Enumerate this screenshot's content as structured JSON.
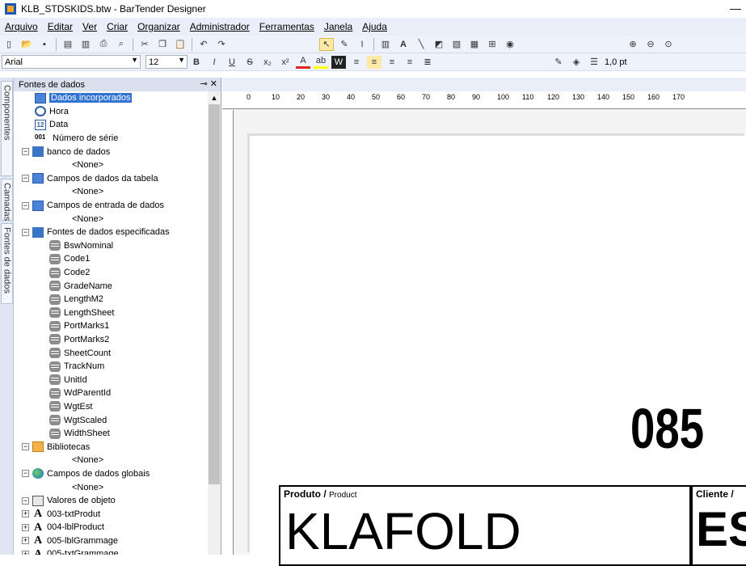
{
  "window": {
    "title": "KLB_STDSKIDS.btw - BarTender Designer",
    "min": "—"
  },
  "menu": [
    "Arquivo",
    "Editar",
    "Ver",
    "Criar",
    "Organizar",
    "Administrador",
    "Ferramentas",
    "Janela",
    "Ajuda"
  ],
  "format": {
    "font": "Arial",
    "size": "12",
    "line_width": "1,0 pt"
  },
  "sidetabs": [
    "Componentes",
    "Camadas",
    "Fontes de dados"
  ],
  "panel": {
    "title": "Fontes de dados",
    "items": [
      {
        "label": "Dados incorporados",
        "icon": "embedded-data-icon",
        "level": 1,
        "selected": true
      },
      {
        "label": "Hora",
        "icon": "clock-icon",
        "level": 1
      },
      {
        "label": "Data",
        "icon": "calendar-icon",
        "level": 1
      },
      {
        "label": "Número de série",
        "icon": "serial-number-icon",
        "level": 1
      },
      {
        "label": "banco de dados",
        "icon": "database-icon",
        "level": 0,
        "exp": "−"
      },
      {
        "label": "<None>",
        "icon": "",
        "level": 2
      },
      {
        "label": "Campos de dados da tabela",
        "icon": "table-icon",
        "level": 0,
        "exp": "−"
      },
      {
        "label": "<None>",
        "icon": "",
        "level": 2
      },
      {
        "label": "Campos de entrada de dados",
        "icon": "form-icon",
        "level": 0,
        "exp": "−"
      },
      {
        "label": "<None>",
        "icon": "",
        "level": 2
      },
      {
        "label": "Fontes de dados especificadas",
        "icon": "named-sources-icon",
        "level": 0,
        "exp": "−"
      },
      {
        "label": "BswNominal",
        "icon": "field-icon",
        "level": 2
      },
      {
        "label": "Code1",
        "icon": "field-icon",
        "level": 2
      },
      {
        "label": "Code2",
        "icon": "field-icon",
        "level": 2
      },
      {
        "label": "GradeName",
        "icon": "field-icon",
        "level": 2
      },
      {
        "label": "LengthM2",
        "icon": "field-icon",
        "level": 2
      },
      {
        "label": "LengthSheet",
        "icon": "field-icon",
        "level": 2
      },
      {
        "label": "PortMarks1",
        "icon": "field-icon",
        "level": 2
      },
      {
        "label": "PortMarks2",
        "icon": "field-icon",
        "level": 2
      },
      {
        "label": "SheetCount",
        "icon": "field-icon",
        "level": 2
      },
      {
        "label": "TrackNum",
        "icon": "field-icon",
        "level": 2
      },
      {
        "label": "UnitId",
        "icon": "field-icon",
        "level": 2
      },
      {
        "label": "WdParentId",
        "icon": "field-icon",
        "level": 2
      },
      {
        "label": "WgtEst",
        "icon": "field-icon",
        "level": 2
      },
      {
        "label": "WgtScaled",
        "icon": "field-icon",
        "level": 2
      },
      {
        "label": "WidthSheet",
        "icon": "field-icon",
        "level": 2
      },
      {
        "label": "Bibliotecas",
        "icon": "library-icon",
        "level": 0,
        "exp": "−"
      },
      {
        "label": "<None>",
        "icon": "",
        "level": 2
      },
      {
        "label": "Campos de dados globais",
        "icon": "globe-icon",
        "level": 0,
        "exp": "−"
      },
      {
        "label": "<None>",
        "icon": "",
        "level": 2
      },
      {
        "label": "Valores de objeto",
        "icon": "object-values-icon",
        "level": 0,
        "exp": "−"
      },
      {
        "label": "003-txtProdut",
        "icon": "text-object-icon",
        "level": 1,
        "exp": "+"
      },
      {
        "label": "004-lblProduct",
        "icon": "text-object-icon",
        "level": 1,
        "exp": "+"
      },
      {
        "label": "005-lblGrammage",
        "icon": "text-object-icon",
        "level": 1,
        "exp": "+"
      },
      {
        "label": "005-txtGrammage",
        "icon": "text-object-icon",
        "level": 1,
        "exp": "+"
      }
    ]
  },
  "ruler": [
    "0",
    "10",
    "20",
    "30",
    "40",
    "50",
    "60",
    "70",
    "80",
    "90",
    "100",
    "110",
    "120",
    "130",
    "140",
    "150",
    "160",
    "170"
  ],
  "label": {
    "number": "085",
    "product_label": "Produto /",
    "product_label_en": "Product",
    "product_value": "KLAFOLD",
    "client_label": "Cliente /",
    "client_value": "ES"
  }
}
